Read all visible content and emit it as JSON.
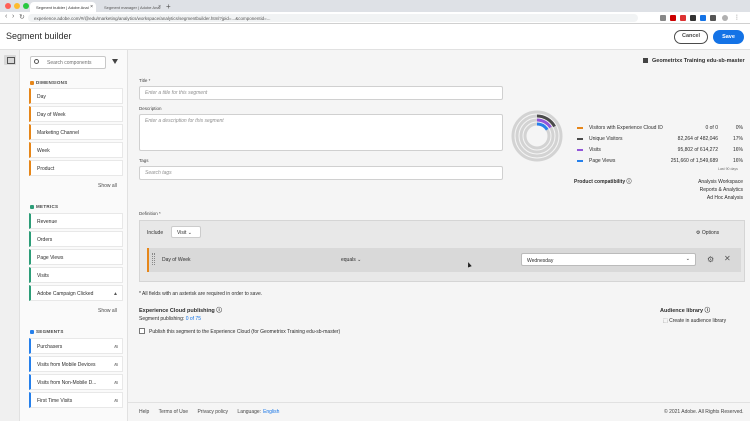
{
  "browser": {
    "tabs": [
      {
        "label": "Segment builder | Adobe Anal"
      },
      {
        "label": "Segment manager | Adobe Anal"
      }
    ],
    "url": "experience.adobe.com/#/@edu/marketing/analytics/workspace/analytics/segmentbuilder.html?jpid=...&componentid=..."
  },
  "header": {
    "title": "Segment builder",
    "cancel_label": "Cancel",
    "save_label": "Save"
  },
  "panel": {
    "search_placeholder": "Search components",
    "dimensions": {
      "title": "DIMENSIONS",
      "items": [
        "Day",
        "Day of Week",
        "Marketing Channel",
        "Week",
        "Product"
      ],
      "show_all": "Show all",
      "color": "#e68619"
    },
    "metrics": {
      "title": "METRICS",
      "items": [
        "Revenue",
        "Orders",
        "Page Views",
        "Visits",
        "Adobe Campaign Clicked"
      ],
      "show_all": "Show all",
      "color": "#2d9d78"
    },
    "segments": {
      "title": "SEGMENTS",
      "items": [
        "Purchasers",
        "Visits from Mobile Devices",
        "Visits from Non-Mobile D...",
        "First Time Visits"
      ],
      "color": "#2680eb"
    }
  },
  "main": {
    "report_suite": "Geometrixx Training edu-sb-master",
    "title_label": "Title *",
    "title_placeholder": "Enter a title for this segment",
    "desc_label": "Description",
    "desc_placeholder": "Enter a description for this segment",
    "tags_label": "Tags",
    "tags_placeholder": "Search tags",
    "definition_label": "Definition *",
    "include_label": "Include",
    "include_value": "Visit",
    "options_label": "Options",
    "rule": {
      "dimension": "Day of Week",
      "operator": "equals",
      "value": "Wednesday"
    },
    "required_note": "* All fields with an asterisk are required in order to save.",
    "ecp": {
      "title": "Experience Cloud publishing",
      "sub_prefix": "Segment publishing:",
      "sub_link": "0 of 75",
      "checkbox_label": "Publish this segment to the Experience Cloud (for Geometrixx Training edu-sb-master)"
    },
    "audience_library": {
      "title": "Audience library",
      "link": "Create in audience library"
    }
  },
  "summary": {
    "rows": [
      {
        "name": "Visitors with Experience Cloud ID",
        "value": "0 of 0",
        "pct": "0%",
        "color": "#e68619"
      },
      {
        "name": "Unique Visitors",
        "value": "82,264 of 482,046",
        "pct": "17%",
        "color": "#4b4b4b"
      },
      {
        "name": "Visits",
        "value": "95,802 of 614,272",
        "pct": "16%",
        "color": "#9256d9"
      },
      {
        "name": "Page Views",
        "value": "251,660 of 1,549,689",
        "pct": "16%",
        "color": "#2680eb"
      }
    ],
    "last_days": "Last 90 days",
    "compat_label": "Product compatibility",
    "compat_items": [
      "Analysis Workspace",
      "Reports & Analytics",
      "Ad Hoc Analysis"
    ],
    "donut_fractions": [
      0.0,
      0.17,
      0.16,
      0.16
    ]
  },
  "footer": {
    "links": [
      "Help",
      "Terms of Use",
      "Privacy policy",
      "Language:"
    ],
    "language": "English",
    "copyright": "© 2021 Adobe. All Rights Reserved."
  }
}
